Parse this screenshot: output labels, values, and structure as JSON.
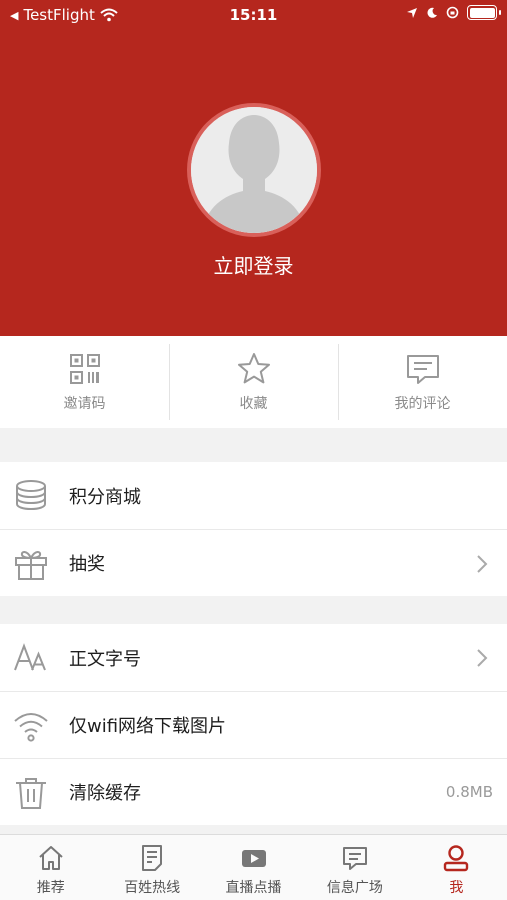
{
  "status_bar": {
    "carrier": "TestFlight",
    "time": "15:11"
  },
  "profile": {
    "login_label": "立即登录"
  },
  "quick_actions": [
    {
      "label": "邀请码",
      "icon": "qr-code-icon"
    },
    {
      "label": "收藏",
      "icon": "star-icon"
    },
    {
      "label": "我的评论",
      "icon": "comment-icon"
    }
  ],
  "menu_group_1": [
    {
      "label": "积分商城",
      "icon": "coin-stack-icon"
    },
    {
      "label": "抽奖",
      "icon": "gift-icon"
    }
  ],
  "menu_group_2": [
    {
      "label": "正文字号",
      "icon": "font-size-icon"
    },
    {
      "label": "仅wifi网络下载图片",
      "icon": "wifi-icon"
    },
    {
      "label": "清除缓存",
      "icon": "trash-icon",
      "value": "0.8MB"
    }
  ],
  "tabbar": [
    {
      "label": "推荐",
      "icon": "home-icon"
    },
    {
      "label": "百姓热线",
      "icon": "hotline-doc-icon"
    },
    {
      "label": "直播点播",
      "icon": "video-play-icon"
    },
    {
      "label": "信息广场",
      "icon": "message-icon"
    },
    {
      "label": "我",
      "icon": "user-icon",
      "active": true
    }
  ],
  "colors": {
    "brand_red": "#b5271e",
    "text_gray": "#8a8a8a",
    "separator": "#f2f2f2"
  }
}
